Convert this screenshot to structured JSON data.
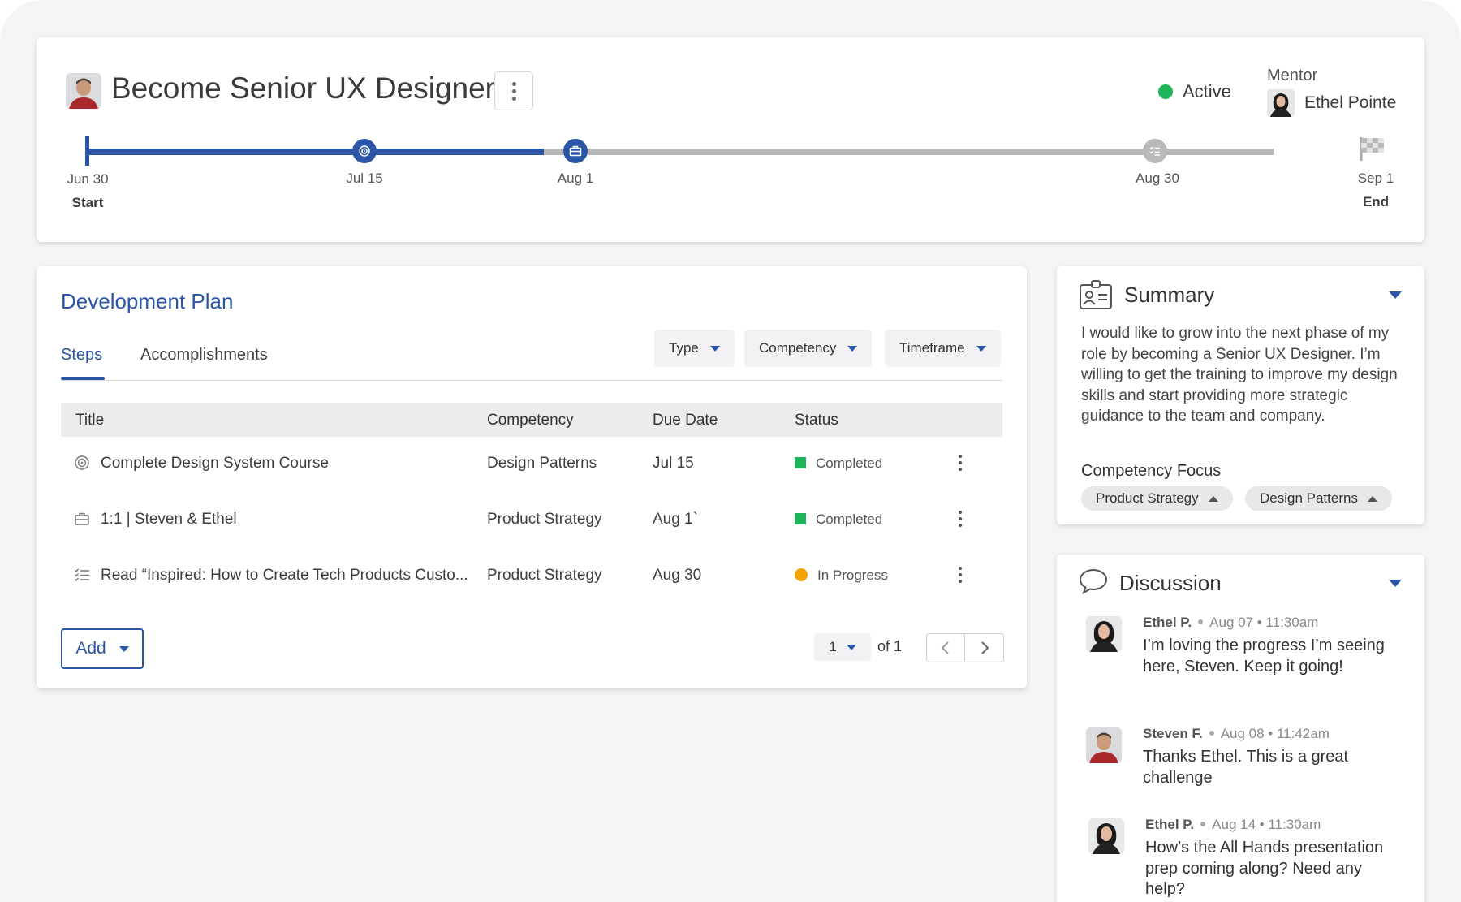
{
  "goal": {
    "title": "Become Senior UX Designer",
    "status": "Active",
    "mentor_label": "Mentor",
    "mentor_name": "Ethel Pointe"
  },
  "timeline": {
    "milestones": [
      {
        "date": "Jun 30",
        "sub": "Start"
      },
      {
        "date": "Jul 15",
        "sub": ""
      },
      {
        "date": "Aug 1",
        "sub": ""
      },
      {
        "date": "Aug 30",
        "sub": ""
      },
      {
        "date": "Sep 1",
        "sub": "End"
      }
    ],
    "completed_through": "Aug 1"
  },
  "dev_plan": {
    "title": "Development Plan",
    "tabs": [
      "Steps",
      "Accomplishments"
    ],
    "active_tab": "Steps",
    "filters": [
      "Type",
      "Competency",
      "Timeframe"
    ],
    "columns": [
      "Title",
      "Competency",
      "Due Date",
      "Status"
    ],
    "rows": [
      {
        "icon": "target-icon",
        "title": "Complete Design System Course",
        "competency": "Design Patterns",
        "due": "Jul 15",
        "status": "Completed"
      },
      {
        "icon": "briefcase-icon",
        "title": "1:1 | Steven & Ethel",
        "competency": "Product Strategy",
        "due": "Aug 1`",
        "status": "Completed"
      },
      {
        "icon": "checklist-icon",
        "title": "Read “Inspired: How to Create Tech Products Custo...",
        "competency": "Product Strategy",
        "due": "Aug 30",
        "status": "In Progress"
      }
    ],
    "add_label": "Add",
    "page": "1",
    "page_of": "of 1"
  },
  "summary": {
    "title": "Summary",
    "text": "I would like to grow into the next phase of my role by becoming a Senior UX Designer. I’m willing to get the training to improve my design skills and start providing more strategic guidance to the team and company.",
    "competency_label": "Competency Focus",
    "chips": [
      "Product Strategy",
      "Design Patterns"
    ]
  },
  "discussion": {
    "title": "Discussion",
    "messages": [
      {
        "author": "Ethel P.",
        "time": "Aug 07 • 11:30am",
        "text": "I’m loving the progress I’m seeing here, Steven. Keep it going!"
      },
      {
        "author": "Steven F.",
        "time": "Aug 08 • 11:42am",
        "text": "Thanks Ethel. This is a great challenge"
      },
      {
        "author": "Ethel P.",
        "time": "Aug 14 • 11:30am",
        "text": "How’s the All Hands presentation prep coming along? Need any help?"
      }
    ]
  },
  "colors": {
    "accent": "#2b56a7",
    "active": "#1db45a",
    "completed": "#1db45a",
    "in_progress": "#f5a300",
    "track_pending": "#b9b9b9"
  }
}
